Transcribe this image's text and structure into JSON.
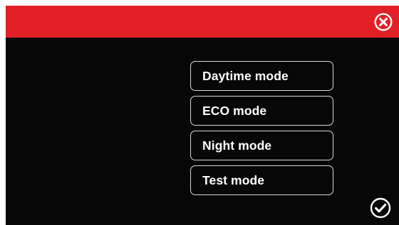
{
  "header": {
    "close_icon": "close-circle-icon",
    "color": "#e21f26"
  },
  "menu": {
    "items": [
      {
        "label": "Daytime mode"
      },
      {
        "label": "ECO mode"
      },
      {
        "label": "Night mode"
      },
      {
        "label": "Test mode"
      }
    ]
  },
  "footer": {
    "confirm_icon": "check-circle-icon"
  },
  "colors": {
    "background": "#070707",
    "accent": "#e21f26",
    "button_border": "#d9d9d9",
    "text": "#ffffff"
  }
}
